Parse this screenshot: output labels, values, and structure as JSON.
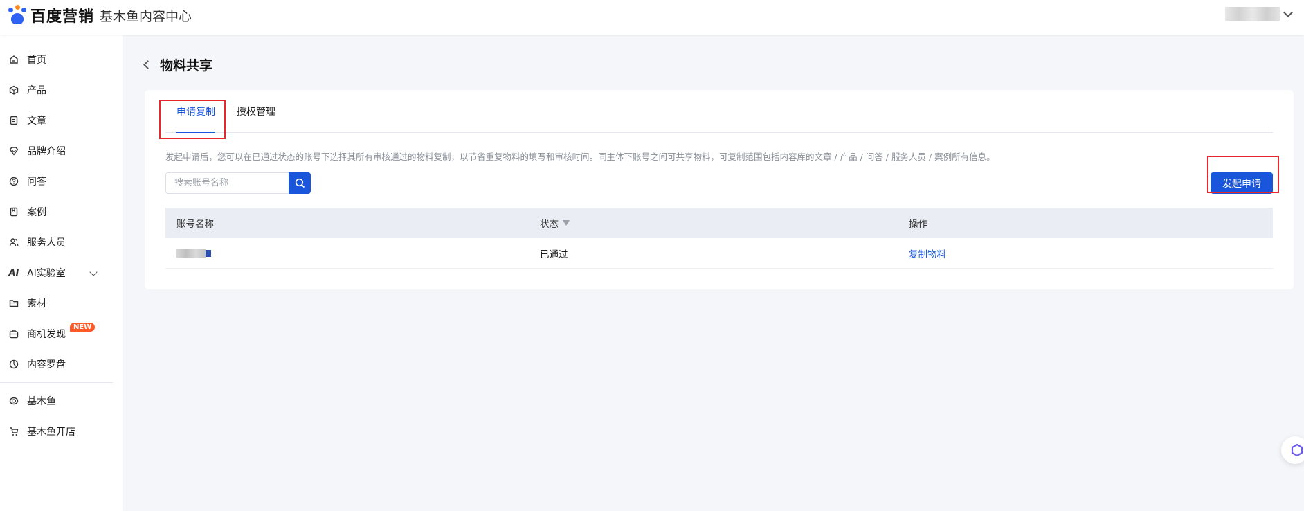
{
  "header": {
    "brand": "百度营销",
    "subtitle": "基木鱼内容中心"
  },
  "sidebar": {
    "items": [
      {
        "label": "首页",
        "icon": "home-icon"
      },
      {
        "label": "产品",
        "icon": "box-icon"
      },
      {
        "label": "文章",
        "icon": "document-icon"
      },
      {
        "label": "品牌介绍",
        "icon": "diamond-icon"
      },
      {
        "label": "问答",
        "icon": "question-icon"
      },
      {
        "label": "案例",
        "icon": "case-icon"
      },
      {
        "label": "服务人员",
        "icon": "people-icon"
      },
      {
        "label": "AI实验室",
        "icon": "ai-icon"
      },
      {
        "label": "素材",
        "icon": "folder-icon"
      },
      {
        "label": "商机发现",
        "icon": "briefcase-icon",
        "badge": "NEW"
      },
      {
        "label": "内容罗盘",
        "icon": "compass-icon"
      },
      {
        "label": "基木鱼",
        "icon": "fish-icon"
      },
      {
        "label": "基木鱼开店",
        "icon": "store-icon"
      }
    ]
  },
  "page": {
    "title": "物料共享"
  },
  "tabs": [
    {
      "label": "申请复制",
      "active": true
    },
    {
      "label": "授权管理",
      "active": false
    }
  ],
  "description": "发起申请后，您可以在已通过状态的账号下选择其所有审核通过的物料复制，以节省重复物料的填写和审核时间。同主体下账号之间可共享物料，可复制范围包括内容库的文章 / 产品 / 问答 / 服务人员 / 案例所有信息。",
  "search": {
    "placeholder": "搜索账号名称",
    "value": ""
  },
  "actions": {
    "apply_label": "发起申请"
  },
  "table": {
    "columns": [
      "账号名称",
      "状态",
      "操作"
    ],
    "rows": [
      {
        "account": "",
        "status": "已通过",
        "action": "复制物料"
      }
    ]
  },
  "colors": {
    "primary": "#1a56db",
    "highlight": "#e8262d",
    "badge": "#ff5a29"
  }
}
